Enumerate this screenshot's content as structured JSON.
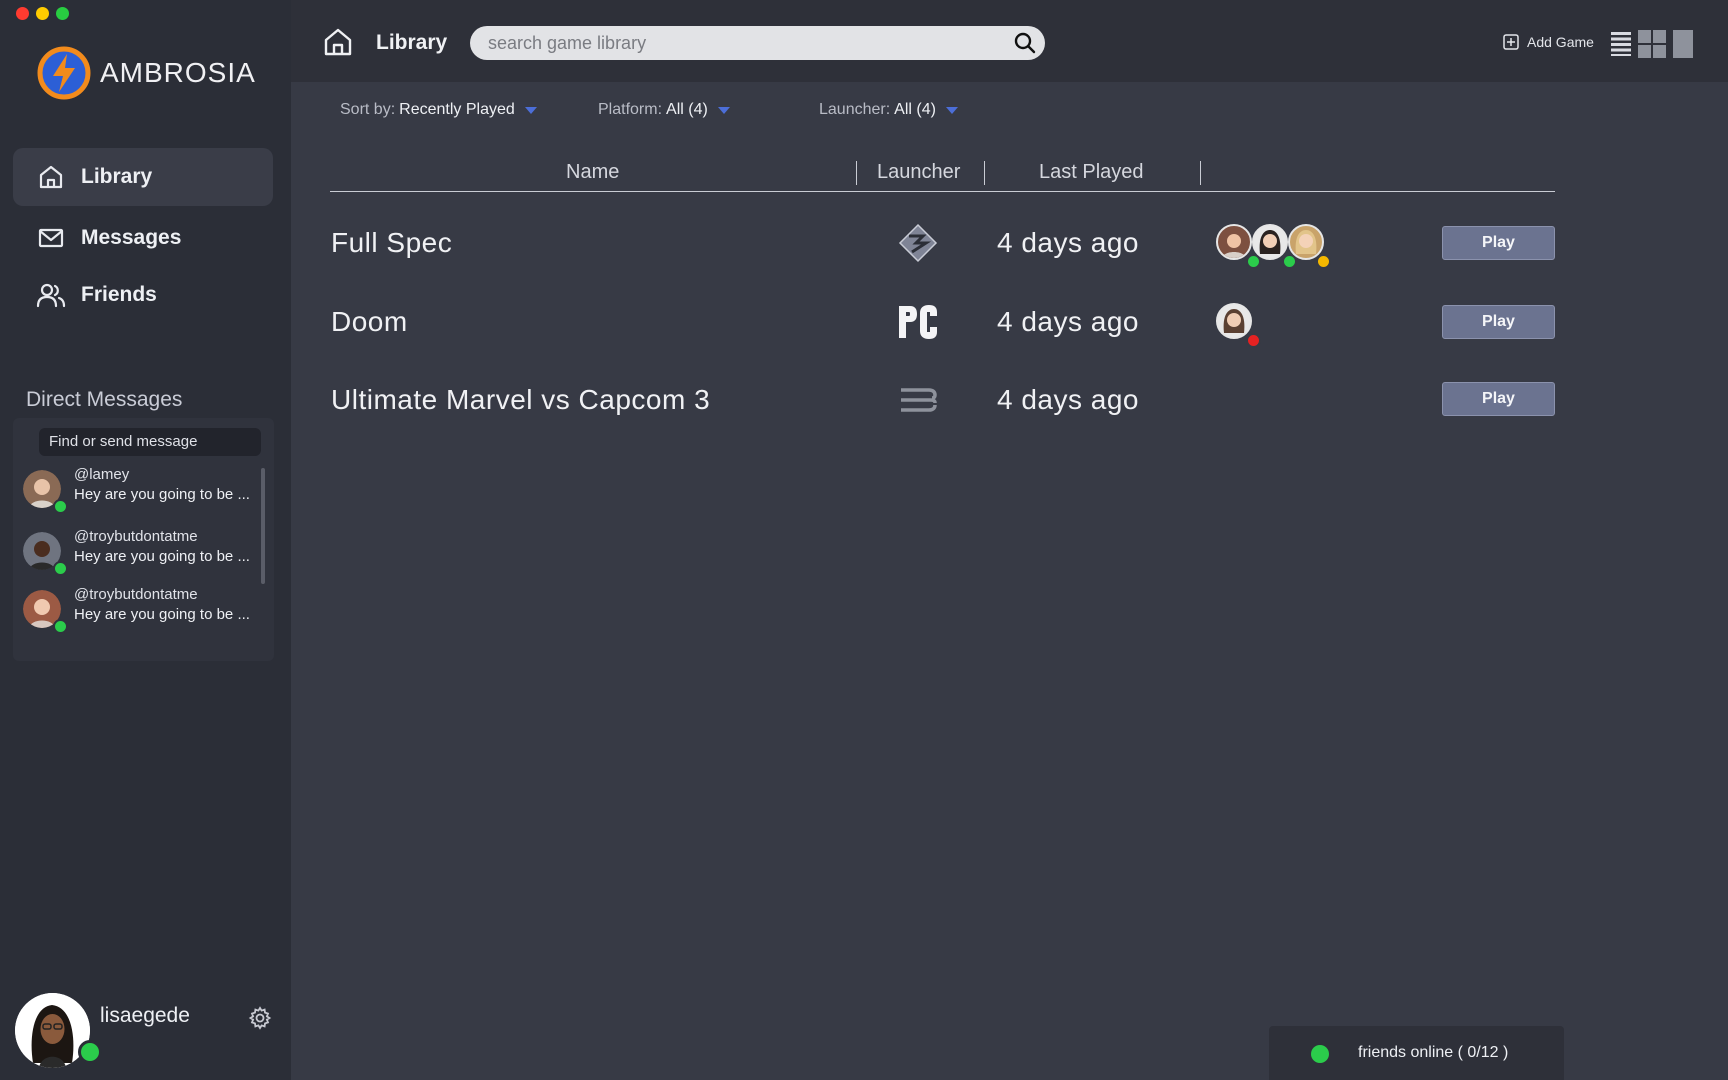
{
  "app": {
    "name": "AMBROSIA"
  },
  "sidebar": {
    "items": [
      {
        "label": "Library",
        "icon": "home-icon",
        "active": true
      },
      {
        "label": "Messages",
        "icon": "mail-icon",
        "active": false
      },
      {
        "label": "Friends",
        "icon": "users-icon",
        "active": false
      }
    ],
    "dm_title": "Direct Messages",
    "dm_search_placeholder": "Find or send message",
    "dms": [
      {
        "handle": "@lamey",
        "message": "Hey are you going to be ...",
        "status": "online"
      },
      {
        "handle": "@troybutdontatme",
        "message": "Hey are you going to be ...",
        "status": "online"
      },
      {
        "handle": "@troybutdontatme",
        "message": "Hey are you going to be ...",
        "status": "online"
      }
    ],
    "user": {
      "name": "lisaegede",
      "status": "online"
    }
  },
  "topbar": {
    "title": "Library",
    "search_placeholder": "search game library",
    "add_game_label": "Add Game"
  },
  "filters": {
    "sort_label": "Sort by:",
    "sort_value": "Recently Played",
    "platform_label": "Platform:",
    "platform_value": "All (4)",
    "launcher_label": "Launcher:",
    "launcher_value": "All (4)"
  },
  "table": {
    "columns": [
      "Name",
      "Launcher",
      "Last Played"
    ],
    "rows": [
      {
        "name": "Full Spec",
        "launcher_icon": "fullspec-launcher-icon",
        "last_played": "4 days ago",
        "play_label": "Play"
      },
      {
        "name": "Doom",
        "launcher_icon": "pc-launcher-icon",
        "last_played": "4 days ago",
        "play_label": "Play"
      },
      {
        "name": "Ultimate Marvel vs Capcom 3",
        "launcher_icon": "stripes-launcher-icon",
        "last_played": "4 days ago",
        "play_label": "Play"
      }
    ]
  },
  "footer": {
    "friends_online": "friends online ( 0/12 )"
  },
  "colors": {
    "accent": "#4c6ed8",
    "online": "#2bcc4b",
    "away": "#f5b800",
    "busy": "#e52222",
    "play_button": "#6b7390",
    "sidebar_bg": "#2b2e37",
    "main_bg": "#373a45"
  }
}
